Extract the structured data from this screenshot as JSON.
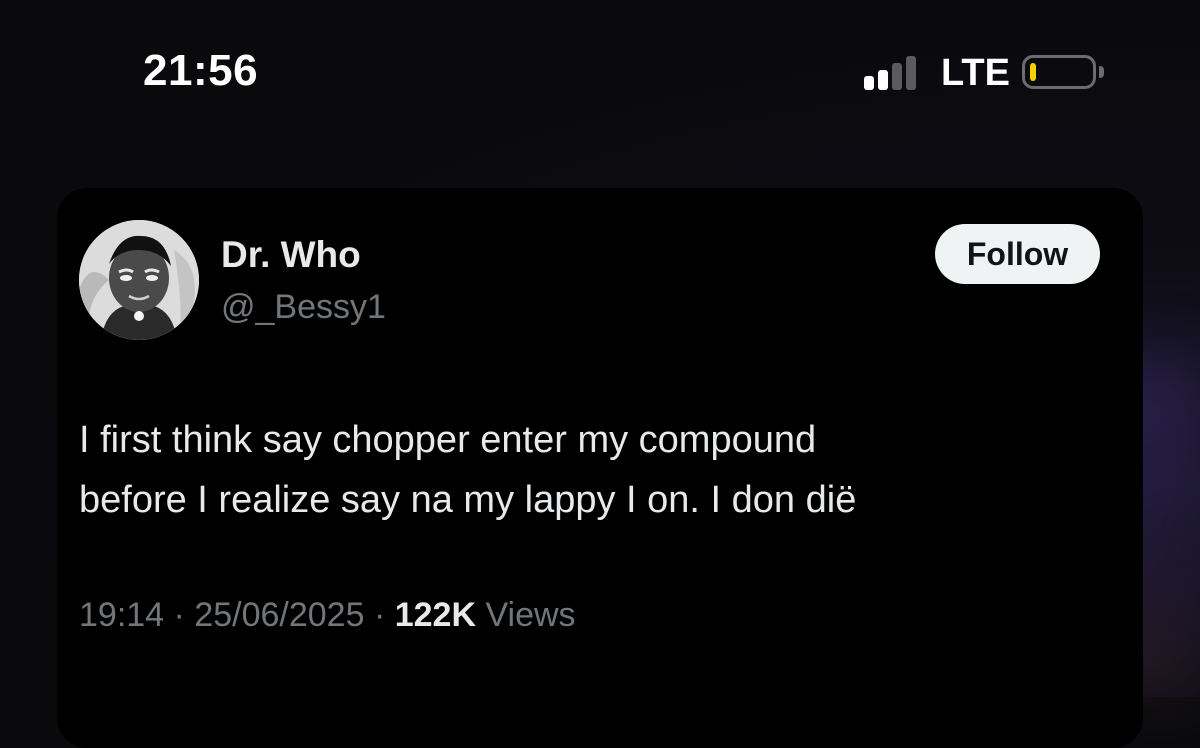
{
  "status_bar": {
    "time": "21:56",
    "network": "LTE",
    "signal_bars_active": 2,
    "signal_bars_total": 4,
    "battery_level": 0.1,
    "battery_color": "#f5d000"
  },
  "tweet": {
    "author_name": "Dr. Who",
    "author_handle": "@_Bessy1",
    "follow_label": "Follow",
    "text_lines": [
      "I first think say chopper enter my compound",
      "before I realize say na my lappy I on. I don dië"
    ],
    "time": "19:14",
    "separator": "·",
    "date": "25/06/2025",
    "views_count": "122K",
    "views_label": "Views"
  },
  "colors": {
    "card_background": "#000000",
    "primary_text": "#e7e9ea",
    "secondary_text": "#71767b",
    "follow_button_bg": "#eff3f4"
  },
  "icons": {
    "signal": "cellular-signal-icon",
    "battery": "battery-icon",
    "avatar": "avatar-image"
  }
}
